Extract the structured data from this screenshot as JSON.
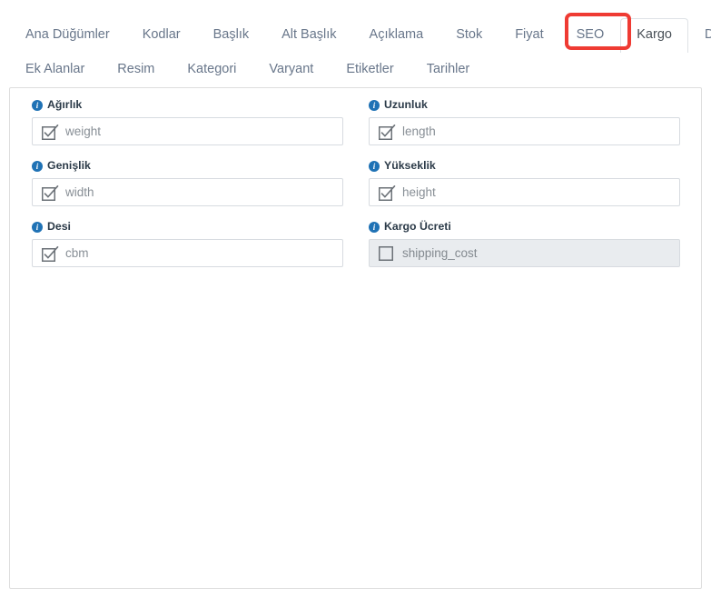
{
  "tabs": {
    "row1": [
      {
        "label": "Ana Düğümler",
        "active": false
      },
      {
        "label": "Kodlar",
        "active": false
      },
      {
        "label": "Başlık",
        "active": false
      },
      {
        "label": "Alt Başlık",
        "active": false
      },
      {
        "label": "Açıklama",
        "active": false
      },
      {
        "label": "Stok",
        "active": false
      },
      {
        "label": "Fiyat",
        "active": false
      },
      {
        "label": "SEO",
        "active": false
      },
      {
        "label": "Kargo",
        "active": true
      },
      {
        "label": "Diğer",
        "active": false
      }
    ],
    "row2": [
      {
        "label": "Ek Alanlar",
        "active": false
      },
      {
        "label": "Resim",
        "active": false
      },
      {
        "label": "Kategori",
        "active": false
      },
      {
        "label": "Varyant",
        "active": false
      },
      {
        "label": "Etiketler",
        "active": false
      },
      {
        "label": "Tarihler",
        "active": false
      }
    ],
    "active_tab": "Kargo",
    "highlight_color": "#ef3b33"
  },
  "panel": {
    "fields": [
      {
        "label": "Ağırlık",
        "value": "weight",
        "checkbox": "checked",
        "disabled": false,
        "column": "left",
        "info_icon": "info-icon"
      },
      {
        "label": "Uzunluk",
        "value": "length",
        "checkbox": "checked",
        "disabled": false,
        "column": "right",
        "info_icon": "info-icon"
      },
      {
        "label": "Genişlik",
        "value": "width",
        "checkbox": "checked",
        "disabled": false,
        "column": "left",
        "info_icon": "info-icon"
      },
      {
        "label": "Yükseklik",
        "value": "height",
        "checkbox": "checked",
        "disabled": false,
        "column": "right",
        "info_icon": "info-icon"
      },
      {
        "label": "Desi",
        "value": "cbm",
        "checkbox": "checked",
        "disabled": false,
        "column": "left",
        "info_icon": "info-icon"
      },
      {
        "label": "Kargo Ücreti",
        "value": "shipping_cost",
        "checkbox": "unchecked",
        "disabled": true,
        "column": "right",
        "info_icon": "info-icon"
      }
    ],
    "info_glyph": "i"
  },
  "colors": {
    "info_blue": "#1f72b5",
    "tab_text": "#68768a",
    "label_text": "#2b3a48",
    "placeholder_text": "#888f96",
    "panel_border": "#dedede",
    "input_border": "#d7dbe0",
    "disabled_bg": "#e9ecef",
    "annotation_red": "#ef3b33"
  }
}
